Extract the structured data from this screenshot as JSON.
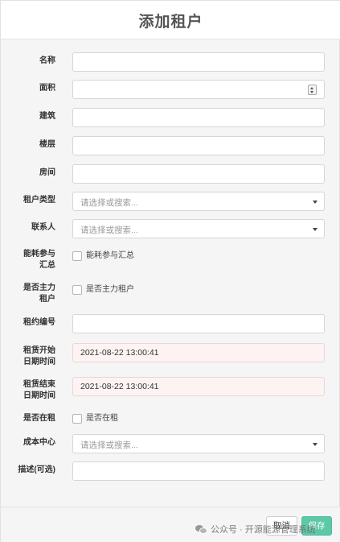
{
  "modal": {
    "title": "添加租户"
  },
  "fields": {
    "name": {
      "label": "名称",
      "value": ""
    },
    "area": {
      "label": "面积",
      "value": ""
    },
    "building": {
      "label": "建筑",
      "value": ""
    },
    "floor": {
      "label": "楼层",
      "value": ""
    },
    "room": {
      "label": "房间",
      "value": ""
    },
    "tenant_type": {
      "label": "租户类型",
      "placeholder": "请选择或搜索..."
    },
    "contact": {
      "label": "联系人",
      "placeholder": "请选择或搜索..."
    },
    "energy_summary": {
      "label_line1": "能耗参与",
      "label_line2": "汇总",
      "checkbox_label": "能耗参与汇总",
      "checked": false
    },
    "main_tenant": {
      "label_line1": "是否主力",
      "label_line2": "租户",
      "checkbox_label": "是否主力租户",
      "checked": false
    },
    "contract_no": {
      "label": "租约编号",
      "value": ""
    },
    "lease_start": {
      "label_line1": "租赁开始",
      "label_line2": "日期时间",
      "value": "2021-08-22 13:00:41"
    },
    "lease_end": {
      "label_line1": "租赁结束",
      "label_line2": "日期时间",
      "value": "2021-08-22 13:00:41"
    },
    "is_renting": {
      "label": "是否在租",
      "checkbox_label": "是否在租",
      "checked": false
    },
    "cost_center": {
      "label": "成本中心",
      "placeholder": "请选择或搜索..."
    },
    "description": {
      "label": "描述(可选)",
      "value": ""
    }
  },
  "footer": {
    "cancel_label": "取消",
    "save_label": "保存"
  },
  "watermark": {
    "text": "公众号 · 开源能源管理系统"
  },
  "colors": {
    "save_button": "#5cc8a8",
    "date_field_bg": "#fdf3f3"
  }
}
